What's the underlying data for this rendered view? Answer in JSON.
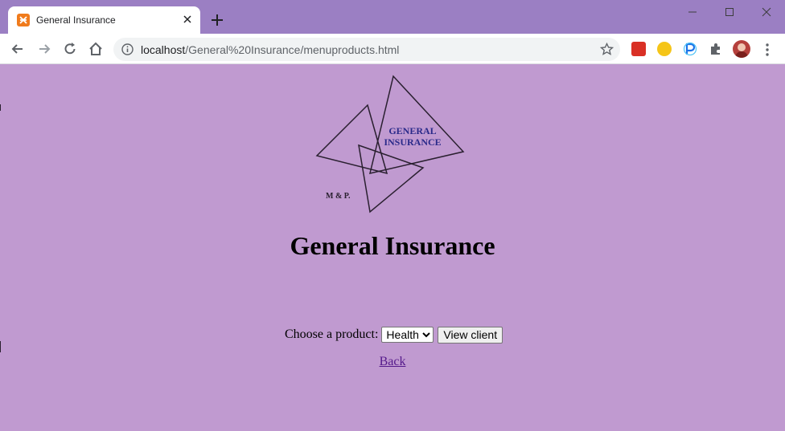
{
  "browser": {
    "tab_title": "General Insurance",
    "url_host": "localhost",
    "url_path": "/General%20Insurance/menuproducts.html"
  },
  "page": {
    "logo": {
      "line1": "GENERAL",
      "line2": "INSURANCE",
      "initials": "M & P."
    },
    "title": "General Insurance",
    "form": {
      "label": "Choose a product:",
      "selected_product": "Health",
      "button_label": "View client"
    },
    "back_link": "Back"
  },
  "colors": {
    "page_background": "#c09ad0",
    "titlebar": "#9b7fc3",
    "link_visited": "#551a8b"
  }
}
